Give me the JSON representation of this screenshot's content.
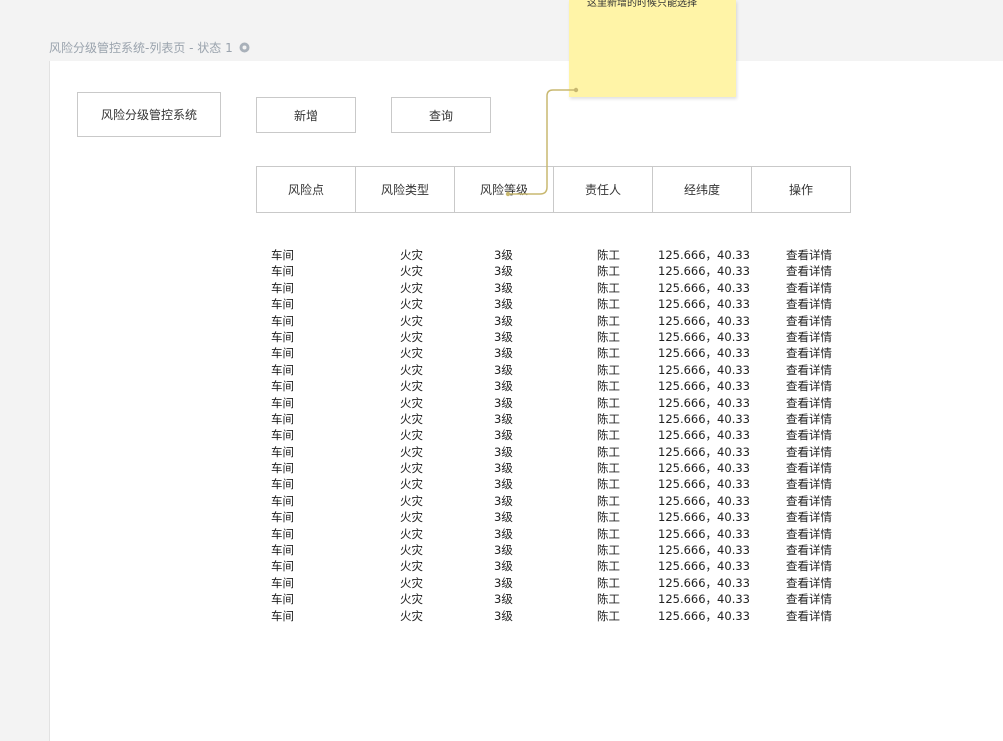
{
  "page": {
    "title": "风险分级管控系统-列表页 - 状态 1"
  },
  "note": {
    "text": "这里新增的时候只能选择"
  },
  "toolbar": {
    "system_label": "风险分级管控系统",
    "add_label": "新增",
    "query_label": "查询"
  },
  "table": {
    "headers": [
      "风险点",
      "风险类型",
      "风险等级",
      "责任人",
      "经纬度",
      "操作"
    ],
    "rows": [
      [
        "车间",
        "火灾",
        "3级",
        "陈工",
        "125.666，40.33",
        "查看详情"
      ],
      [
        "车间",
        "火灾",
        "3级",
        "陈工",
        "125.666，40.33",
        "查看详情"
      ],
      [
        "车间",
        "火灾",
        "3级",
        "陈工",
        "125.666，40.33",
        "查看详情"
      ],
      [
        "车间",
        "火灾",
        "3级",
        "陈工",
        "125.666，40.33",
        "查看详情"
      ],
      [
        "车间",
        "火灾",
        "3级",
        "陈工",
        "125.666，40.33",
        "查看详情"
      ],
      [
        "车间",
        "火灾",
        "3级",
        "陈工",
        "125.666，40.33",
        "查看详情"
      ],
      [
        "车间",
        "火灾",
        "3级",
        "陈工",
        "125.666，40.33",
        "查看详情"
      ],
      [
        "车间",
        "火灾",
        "3级",
        "陈工",
        "125.666，40.33",
        "查看详情"
      ],
      [
        "车间",
        "火灾",
        "3级",
        "陈工",
        "125.666，40.33",
        "查看详情"
      ],
      [
        "车间",
        "火灾",
        "3级",
        "陈工",
        "125.666，40.33",
        "查看详情"
      ],
      [
        "车间",
        "火灾",
        "3级",
        "陈工",
        "125.666，40.33",
        "查看详情"
      ],
      [
        "车间",
        "火灾",
        "3级",
        "陈工",
        "125.666，40.33",
        "查看详情"
      ],
      [
        "车间",
        "火灾",
        "3级",
        "陈工",
        "125.666，40.33",
        "查看详情"
      ],
      [
        "车间",
        "火灾",
        "3级",
        "陈工",
        "125.666，40.33",
        "查看详情"
      ],
      [
        "车间",
        "火灾",
        "3级",
        "陈工",
        "125.666，40.33",
        "查看详情"
      ],
      [
        "车间",
        "火灾",
        "3级",
        "陈工",
        "125.666，40.33",
        "查看详情"
      ],
      [
        "车间",
        "火灾",
        "3级",
        "陈工",
        "125.666，40.33",
        "查看详情"
      ],
      [
        "车间",
        "火灾",
        "3级",
        "陈工",
        "125.666，40.33",
        "查看详情"
      ],
      [
        "车间",
        "火灾",
        "3级",
        "陈工",
        "125.666，40.33",
        "查看详情"
      ],
      [
        "车间",
        "火灾",
        "3级",
        "陈工",
        "125.666，40.33",
        "查看详情"
      ],
      [
        "车间",
        "火灾",
        "3级",
        "陈工",
        "125.666，40.33",
        "查看详情"
      ],
      [
        "车间",
        "火灾",
        "3级",
        "陈工",
        "125.666，40.33",
        "查看详情"
      ],
      [
        "车间",
        "火灾",
        "3级",
        "陈工",
        "125.666，40.33",
        "查看详情"
      ]
    ]
  },
  "icons": {
    "title_settings": "gear-icon"
  },
  "colors": {
    "page_background": "#f3f3f3",
    "canvas_background": "#ffffff",
    "sticky_note": "#fff4a7",
    "connector": "#c8b870",
    "border": "#c9c9c9",
    "title_text": "#9aa3ad"
  }
}
